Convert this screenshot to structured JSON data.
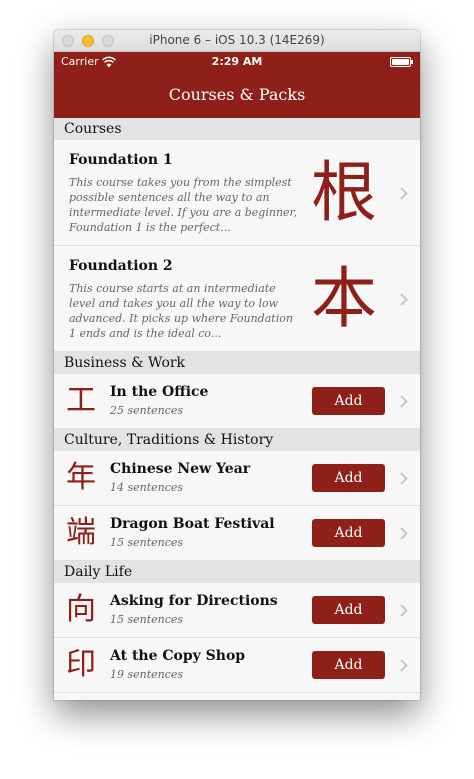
{
  "window": {
    "title": "iPhone 6 – iOS 10.3 (14E269)"
  },
  "status_bar": {
    "carrier": "Carrier",
    "time": "2:29 AM"
  },
  "nav": {
    "title": "Courses & Packs"
  },
  "sections": {
    "courses": {
      "header": "Courses",
      "items": [
        {
          "title": "Foundation 1",
          "description": "This course takes you from the simplest possible sentences all the way to an intermediate level. If you are a beginner, Foundation 1 is the perfect...",
          "char": "根"
        },
        {
          "title": "Foundation 2",
          "description": "This course starts at an intermediate level and takes you all the way to low advanced. It picks up where Foundation 1 ends and is the ideal co...",
          "char": "本"
        }
      ]
    },
    "business": {
      "header": "Business & Work",
      "items": [
        {
          "char": "工",
          "title": "In the Office",
          "count": "25 sentences",
          "button": "Add"
        }
      ]
    },
    "culture": {
      "header": "Culture, Traditions & History",
      "items": [
        {
          "char": "年",
          "title": "Chinese New Year",
          "count": "14 sentences",
          "button": "Add"
        },
        {
          "char": "端",
          "title": "Dragon Boat Festival",
          "count": "15 sentences",
          "button": "Add"
        }
      ]
    },
    "daily": {
      "header": "Daily Life",
      "items": [
        {
          "char": "向",
          "title": "Asking for Directions",
          "count": "15 sentences",
          "button": "Add"
        },
        {
          "char": "印",
          "title": "At the Copy Shop",
          "count": "19 sentences",
          "button": "Add"
        }
      ]
    }
  },
  "icons": {
    "wifi": "wifi-icon",
    "battery": "battery-icon",
    "chevron": "chevron-right-icon"
  },
  "colors": {
    "brand": "#8e2019",
    "section_bg": "#e3e3e3",
    "row_bg": "#f7f7f7",
    "chevron": "#c7c7cc"
  }
}
